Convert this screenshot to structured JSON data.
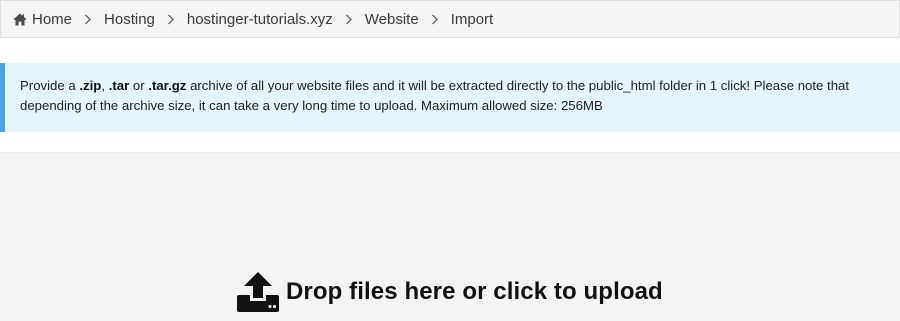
{
  "breadcrumb": {
    "items": [
      {
        "label": "Home",
        "icon": "home-icon"
      },
      {
        "label": "Hosting"
      },
      {
        "label": "hostinger-tutorials.xyz"
      },
      {
        "label": "Website"
      },
      {
        "label": "Import"
      }
    ]
  },
  "notice": {
    "prefix": "Provide a ",
    "ext1": ".zip",
    "comma": ", ",
    "ext2": ".tar",
    "or": " or ",
    "ext3": ".tar.gz",
    "suffix": " archive of all your website files and it will be extracted directly to the public_html folder in 1 click! Please note that depending of the archive size, it can take a very long time to upload. Maximum allowed size: 256MB"
  },
  "dropzone": {
    "label": "Drop files here or click to upload",
    "icon": "upload-icon"
  },
  "colors": {
    "notice_bg": "#e6f4fb",
    "notice_border": "#4aa3df",
    "breadcrumb_bg": "#f5f5f5",
    "dropzone_bg": "#f4f4f4"
  }
}
